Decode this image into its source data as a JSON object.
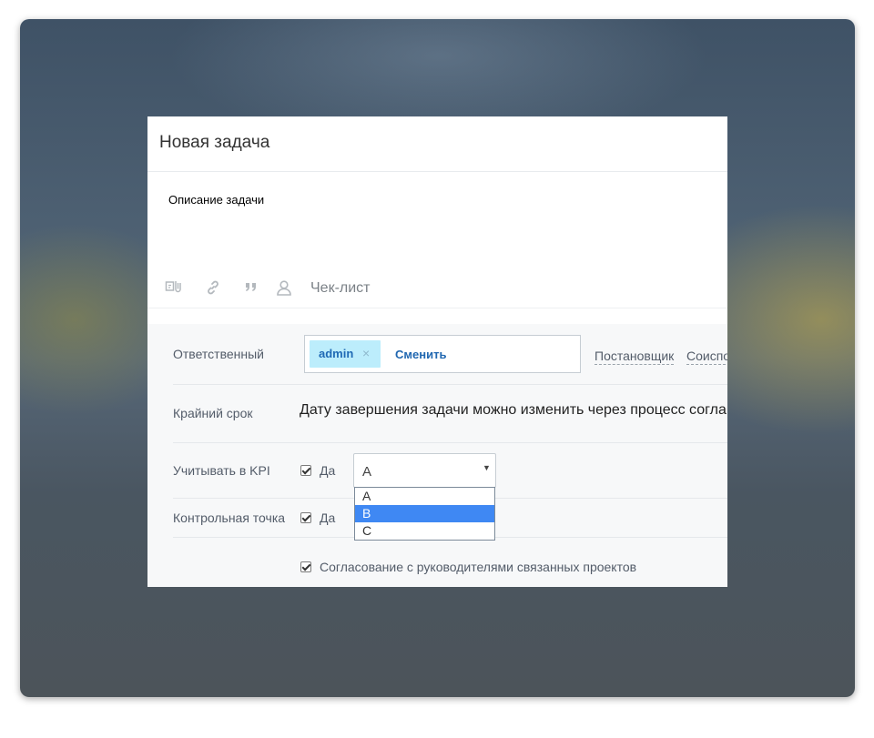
{
  "dialog": {
    "title": "Новая задача",
    "description_placeholder": "Описание задачи"
  },
  "toolbar": {
    "icons": [
      "attach-icon",
      "link-icon",
      "quote-icon",
      "user-mention-icon"
    ],
    "checklist_label": "Чек-лист"
  },
  "form": {
    "responsible": {
      "label": "Ответственный",
      "user": "admin",
      "remove_symbol": "×",
      "change_label": "Сменить",
      "role_links": [
        "Постановщик",
        "Соиспо"
      ]
    },
    "deadline": {
      "label": "Крайний срок",
      "text": "Дату завершения задачи можно изменить через процесс согла"
    },
    "kpi": {
      "label": "Учитывать в KPI",
      "checked": true,
      "checkbox_label": "Да",
      "select_value": "A",
      "select_arrow": "▼",
      "options": [
        "A",
        "B",
        "C"
      ],
      "highlighted_option": "B"
    },
    "checkpoint": {
      "label": "Контрольная точка",
      "checked": true,
      "checkbox_label": "Да"
    },
    "approval": {
      "checked": true,
      "checkbox_label": "Согласование с руководителями связанных проектов"
    }
  },
  "colors": {
    "accent_link": "#2067b0",
    "user_tag_bg": "#bcedfc",
    "option_highlight": "#3f88f3"
  }
}
